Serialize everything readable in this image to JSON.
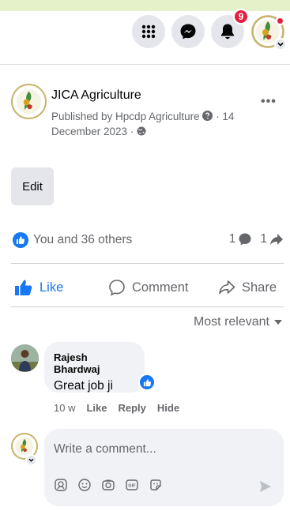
{
  "topbar": {
    "menu_icon": "grid-menu-icon",
    "messenger_icon": "messenger-icon",
    "notifications_icon": "bell-icon",
    "notification_count": "9"
  },
  "post": {
    "page_name": "JICA Agriculture",
    "published_line1": "Published by Hpcdp Agriculture",
    "date_suffix": "· 14",
    "published_line2": "December 2023 ·",
    "more_label": "•••",
    "edit_label": "Edit"
  },
  "stats": {
    "reactions_text": "You and 36 others",
    "comment_count": "1",
    "share_count": "1"
  },
  "actions": {
    "like": "Like",
    "comment": "Comment",
    "share": "Share"
  },
  "sort": {
    "label": "Most relevant"
  },
  "comment": {
    "author": "Rajesh Bhardwaj",
    "text": "Great job ji",
    "time": "10 w",
    "like": "Like",
    "reply": "Reply",
    "hide": "Hide"
  },
  "composer": {
    "placeholder": "Write a comment..."
  },
  "colors": {
    "accent": "#1877f2",
    "badge": "#e41e3f",
    "muted": "#65676b"
  }
}
